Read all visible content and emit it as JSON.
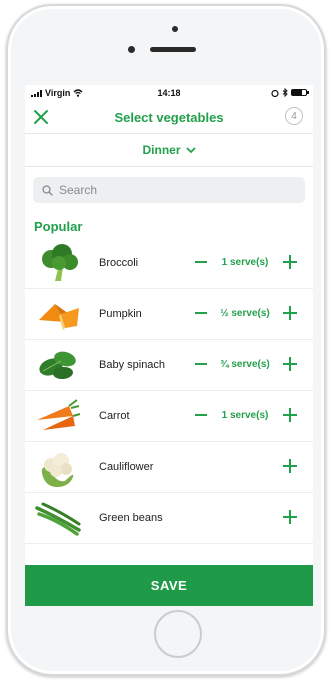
{
  "status_bar": {
    "carrier": "Virgin",
    "time": "14:18"
  },
  "nav": {
    "title": "Select vegetables",
    "selected_count": "4"
  },
  "meal_selector": {
    "label": "Dinner"
  },
  "search": {
    "placeholder": "Search"
  },
  "section": {
    "title": "Popular"
  },
  "vegetables": [
    {
      "name": "Broccoli",
      "amount": "1 serve(s)",
      "icon": "broccoli"
    },
    {
      "name": "Pumpkin",
      "amount": "½ serve(s)",
      "icon": "pumpkin"
    },
    {
      "name": "Baby spinach",
      "amount": "¾ serve(s)",
      "icon": "spinach"
    },
    {
      "name": "Carrot",
      "amount": "1 serve(s)",
      "icon": "carrot"
    },
    {
      "name": "Cauliflower",
      "amount": "",
      "icon": "cauliflower"
    },
    {
      "name": "Green beans",
      "amount": "",
      "icon": "green-beans"
    }
  ],
  "save_label": "SAVE",
  "colors": {
    "accent": "#22a04b",
    "save_bar": "#1e9a48"
  }
}
